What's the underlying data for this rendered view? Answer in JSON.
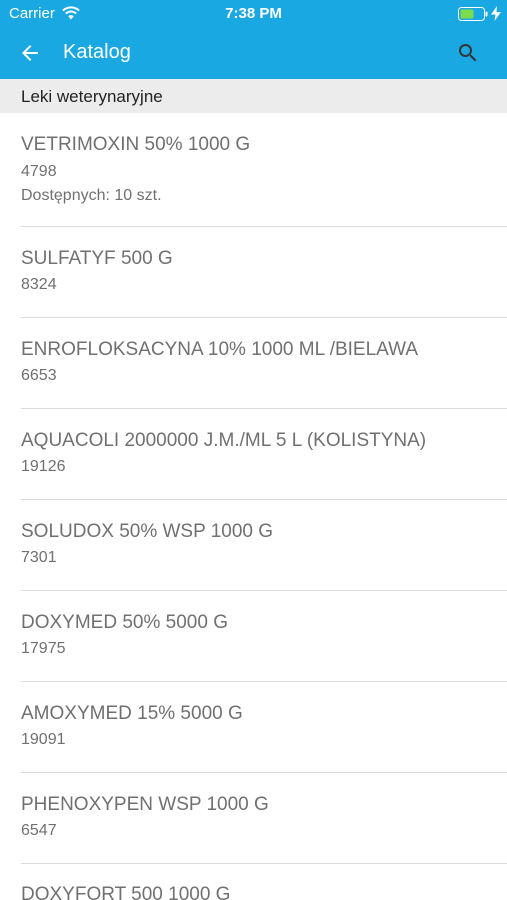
{
  "status_bar": {
    "carrier": "Carrier",
    "time": "7:38 PM",
    "wifi_icon": "wifi-icon",
    "battery_icon": "battery-icon",
    "charging_icon": "charging-bolt-icon"
  },
  "app_bar": {
    "title": "Katalog",
    "back_icon": "arrow-left-icon",
    "search_icon": "search-icon",
    "color": "#1aa8e3"
  },
  "section": {
    "title": "Leki weterynaryjne"
  },
  "items": [
    {
      "name": "VETRIMOXIN 50% 1000 G",
      "code": "4798",
      "availability": "Dostępnych: 10 szt."
    },
    {
      "name": "SULFATYF 500 G",
      "code": "8324"
    },
    {
      "name": "ENROFLOKSACYNA 10% 1000 ML /BIELAWA",
      "code": "6653"
    },
    {
      "name": "AQUACOLI 2000000 J.M./ML 5 L (KOLISTYNA)",
      "code": "19126"
    },
    {
      "name": "SOLUDOX 50% WSP 1000 G",
      "code": "7301"
    },
    {
      "name": "DOXYMED 50% 5000 G",
      "code": "17975"
    },
    {
      "name": "AMOXYMED 15% 5000 G",
      "code": "19091"
    },
    {
      "name": "PHENOXYPEN WSP 1000 G",
      "code": "6547"
    },
    {
      "name": "DOXYFORT 500 1000 G",
      "code": ""
    }
  ]
}
